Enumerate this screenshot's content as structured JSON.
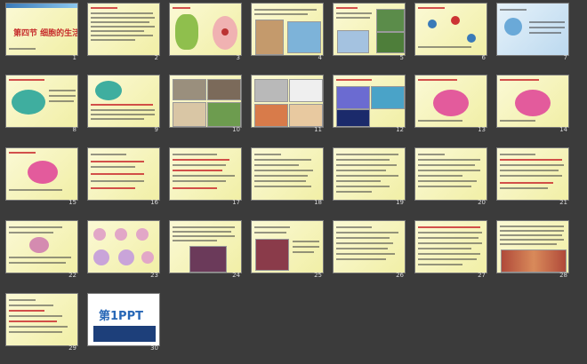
{
  "slides": [
    {
      "number": "1",
      "title": "第四节  细胞的生活"
    },
    {
      "number": "2"
    },
    {
      "number": "3"
    },
    {
      "number": "4"
    },
    {
      "number": "5"
    },
    {
      "number": "6"
    },
    {
      "number": "7"
    },
    {
      "number": "8"
    },
    {
      "number": "9"
    },
    {
      "number": "10"
    },
    {
      "number": "11"
    },
    {
      "number": "12"
    },
    {
      "number": "13"
    },
    {
      "number": "14"
    },
    {
      "number": "15"
    },
    {
      "number": "16"
    },
    {
      "number": "17"
    },
    {
      "number": "18"
    },
    {
      "number": "19"
    },
    {
      "number": "20"
    },
    {
      "number": "21"
    },
    {
      "number": "22"
    },
    {
      "number": "23"
    },
    {
      "number": "24"
    },
    {
      "number": "25"
    },
    {
      "number": "26"
    },
    {
      "number": "27"
    },
    {
      "number": "28"
    },
    {
      "number": "29"
    },
    {
      "number": "30",
      "logo": "第1PPT"
    }
  ],
  "colors": {
    "background": "#3b3b3b",
    "slide_bg": "#f4f2b8",
    "accent_red": "#c62b2b",
    "accent_blue": "#2767b6"
  }
}
